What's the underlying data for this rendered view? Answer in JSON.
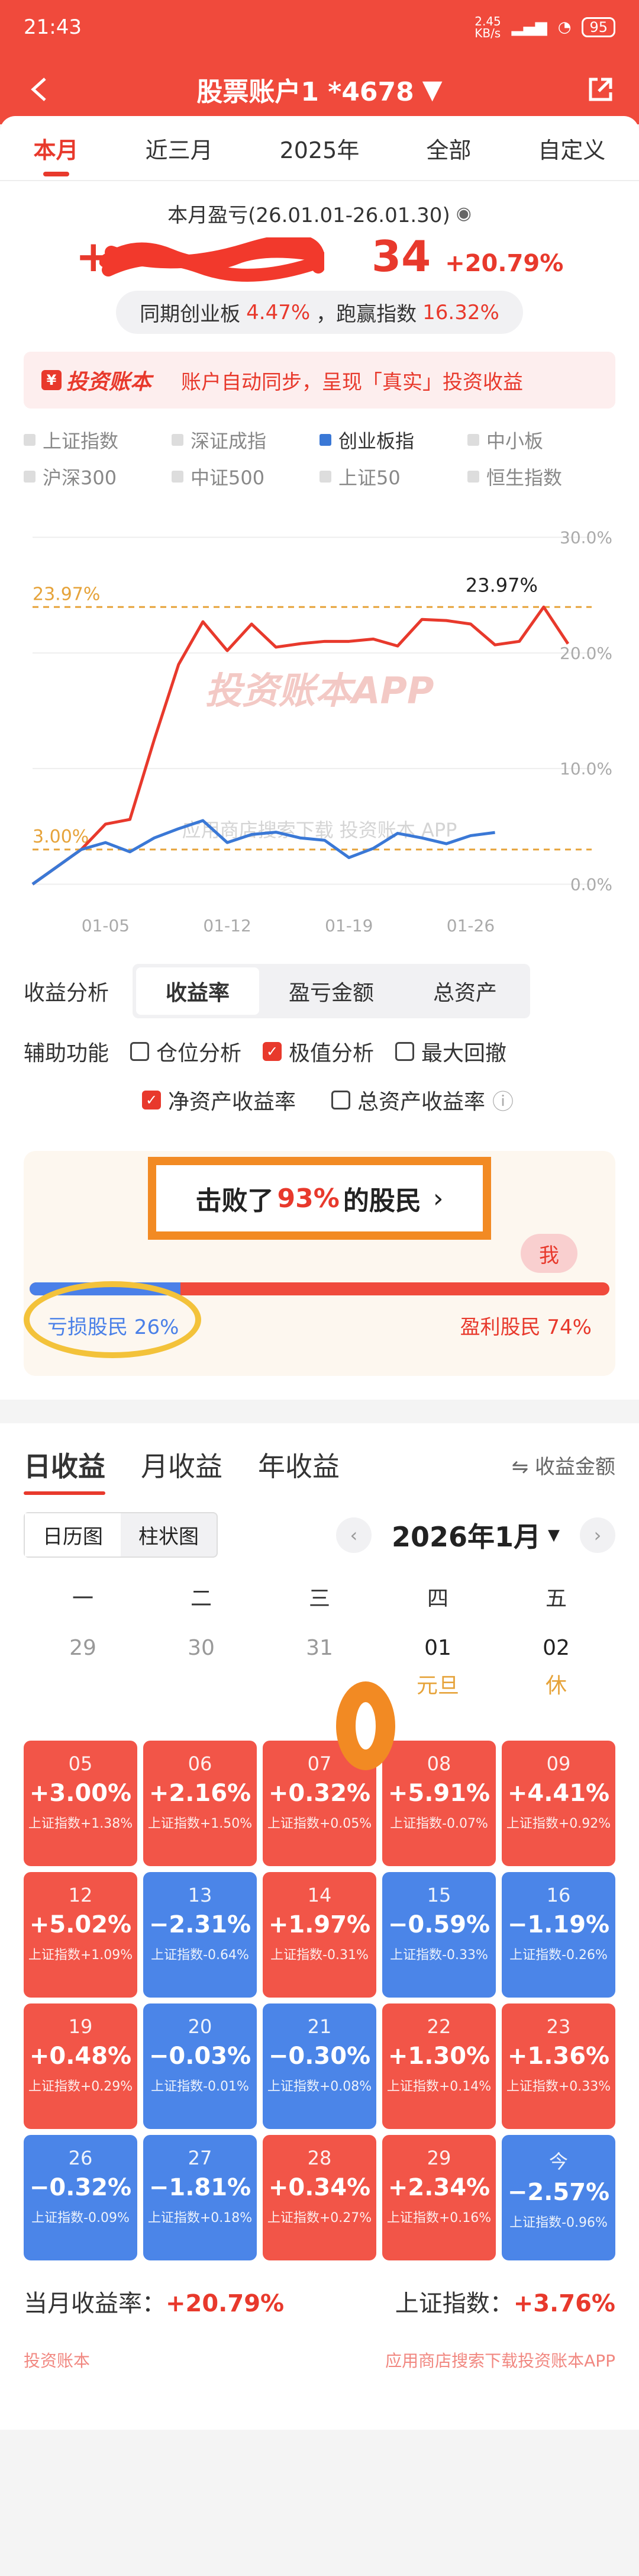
{
  "status": {
    "time": "21:43",
    "speed": "2.45\nKB/s",
    "battery": "95"
  },
  "header": {
    "title": "股票账户1 *4678"
  },
  "tabs": [
    "本月",
    "近三月",
    "2025年",
    "全部",
    "自定义"
  ],
  "summary": {
    "label": "本月盈亏(26.01.01-26.01.30)",
    "amount_prefix": "+",
    "amount_suffix": "34",
    "pct": "+20.79%",
    "compare_prefix": "同期创业板",
    "compare_val": "4.47%",
    "compare_mid": "，跑赢指数",
    "compare_val2": "16.32%"
  },
  "banner": {
    "brand": "投资账本",
    "text": "账户自动同步，呈现「真实」投资收益"
  },
  "legend": [
    "上证指数",
    "深证成指",
    "创业板指",
    "中小板",
    "沪深300",
    "中证500",
    "上证50",
    "恒生指数"
  ],
  "colors": {
    "account": "#e8392c",
    "index": "#3a78d6",
    "ref": "#e6a33a"
  },
  "chart_data": {
    "type": "line",
    "x_ticks": [
      "01-05",
      "01-12",
      "01-19",
      "01-26"
    ],
    "y_ticks": [
      "30.0%",
      "20.0%",
      "10.0%",
      "0.0%"
    ],
    "ref_labels": [
      "23.97%",
      "3.00%"
    ],
    "max_label": "23.97%",
    "watermark": "投资账本APP",
    "watermark2": "应用商店搜索下载",
    "watermark2_brand": "投资账本",
    "watermark2_app": "APP",
    "ylim": [
      -1,
      31
    ],
    "series": [
      {
        "values": [
          0,
          1.5,
          3.0,
          5.2,
          5.6,
          12.5,
          19,
          22.7,
          20.2,
          22.5,
          20.5,
          20.8,
          21.0,
          21.0,
          21.2,
          20.6,
          22.9,
          22.8,
          22.5,
          20.7,
          21.0,
          23.97,
          20.79
        ]
      },
      {
        "values": [
          0,
          1.5,
          3.0,
          3.6,
          2.8,
          4.0,
          4.8,
          5.5,
          3.6,
          4.3,
          4.5,
          4.0,
          3.8,
          2.3,
          3.1,
          4.4,
          4.0,
          3.5,
          4.2,
          4.47
        ]
      }
    ]
  },
  "analysis": {
    "label": "收益分析",
    "options": [
      "收益率",
      "盈亏金额",
      "总资产"
    ]
  },
  "aux": {
    "label": "辅助功能",
    "cb1": "仓位分析",
    "cb2": "极值分析",
    "cb3": "最大回撤",
    "cb4": "净资产收益率",
    "cb5": "总资产收益率",
    "info": "ⓘ"
  },
  "beat": {
    "prefix": "击败了",
    "pct": "93%",
    "suffix": "的股民",
    "me": "我",
    "loss": "亏损股民 26%",
    "gain": "盈利股民 74%"
  },
  "daily": {
    "tabs": [
      "日收益",
      "月收益",
      "年收益"
    ],
    "right": "⇋ 收益金额"
  },
  "calendar": {
    "views": [
      "日历图",
      "柱状图"
    ],
    "month": "2026年1月",
    "weekdays": [
      "一",
      "二",
      "三",
      "四",
      "五"
    ],
    "prev": [
      "29",
      "30",
      "31",
      "01",
      "02"
    ],
    "holidays": [
      "元旦",
      "休"
    ],
    "index_label": "上证指数",
    "cells": [
      {
        "d": "05",
        "v": "+3.00%",
        "s": "+1.38%",
        "up": true
      },
      {
        "d": "06",
        "v": "+2.16%",
        "s": "+1.50%",
        "up": true
      },
      {
        "d": "07",
        "v": "+0.32%",
        "s": "+0.05%",
        "up": true
      },
      {
        "d": "08",
        "v": "+5.91%",
        "s": "-0.07%",
        "up": true
      },
      {
        "d": "09",
        "v": "+4.41%",
        "s": "+0.92%",
        "up": true
      },
      {
        "d": "12",
        "v": "+5.02%",
        "s": "+1.09%",
        "up": true
      },
      {
        "d": "13",
        "v": "−2.31%",
        "s": "-0.64%",
        "up": false
      },
      {
        "d": "14",
        "v": "+1.97%",
        "s": "-0.31%",
        "up": true
      },
      {
        "d": "15",
        "v": "−0.59%",
        "s": "-0.33%",
        "up": false
      },
      {
        "d": "16",
        "v": "−1.19%",
        "s": "-0.26%",
        "up": false
      },
      {
        "d": "19",
        "v": "+0.48%",
        "s": "+0.29%",
        "up": true
      },
      {
        "d": "20",
        "v": "−0.03%",
        "s": "-0.01%",
        "up": false
      },
      {
        "d": "21",
        "v": "−0.30%",
        "s": "+0.08%",
        "up": false
      },
      {
        "d": "22",
        "v": "+1.30%",
        "s": "+0.14%",
        "up": true
      },
      {
        "d": "23",
        "v": "+1.36%",
        "s": "+0.33%",
        "up": true
      },
      {
        "d": "26",
        "v": "−0.32%",
        "s": "-0.09%",
        "up": false
      },
      {
        "d": "27",
        "v": "−1.81%",
        "s": "+0.18%",
        "up": false
      },
      {
        "d": "28",
        "v": "+0.34%",
        "s": "+0.27%",
        "up": true
      },
      {
        "d": "29",
        "v": "+2.34%",
        "s": "+0.16%",
        "up": true
      },
      {
        "d": "今",
        "v": "−2.57%",
        "s": "-0.96%",
        "up": false
      }
    ]
  },
  "totals": {
    "left_label": "当月收益率：",
    "left_val": "+20.79%",
    "right_label": "上证指数：",
    "right_val": "+3.76%"
  },
  "footer": {
    "left": "投资账本",
    "right": "应用商店搜索下载投资账本APP"
  }
}
